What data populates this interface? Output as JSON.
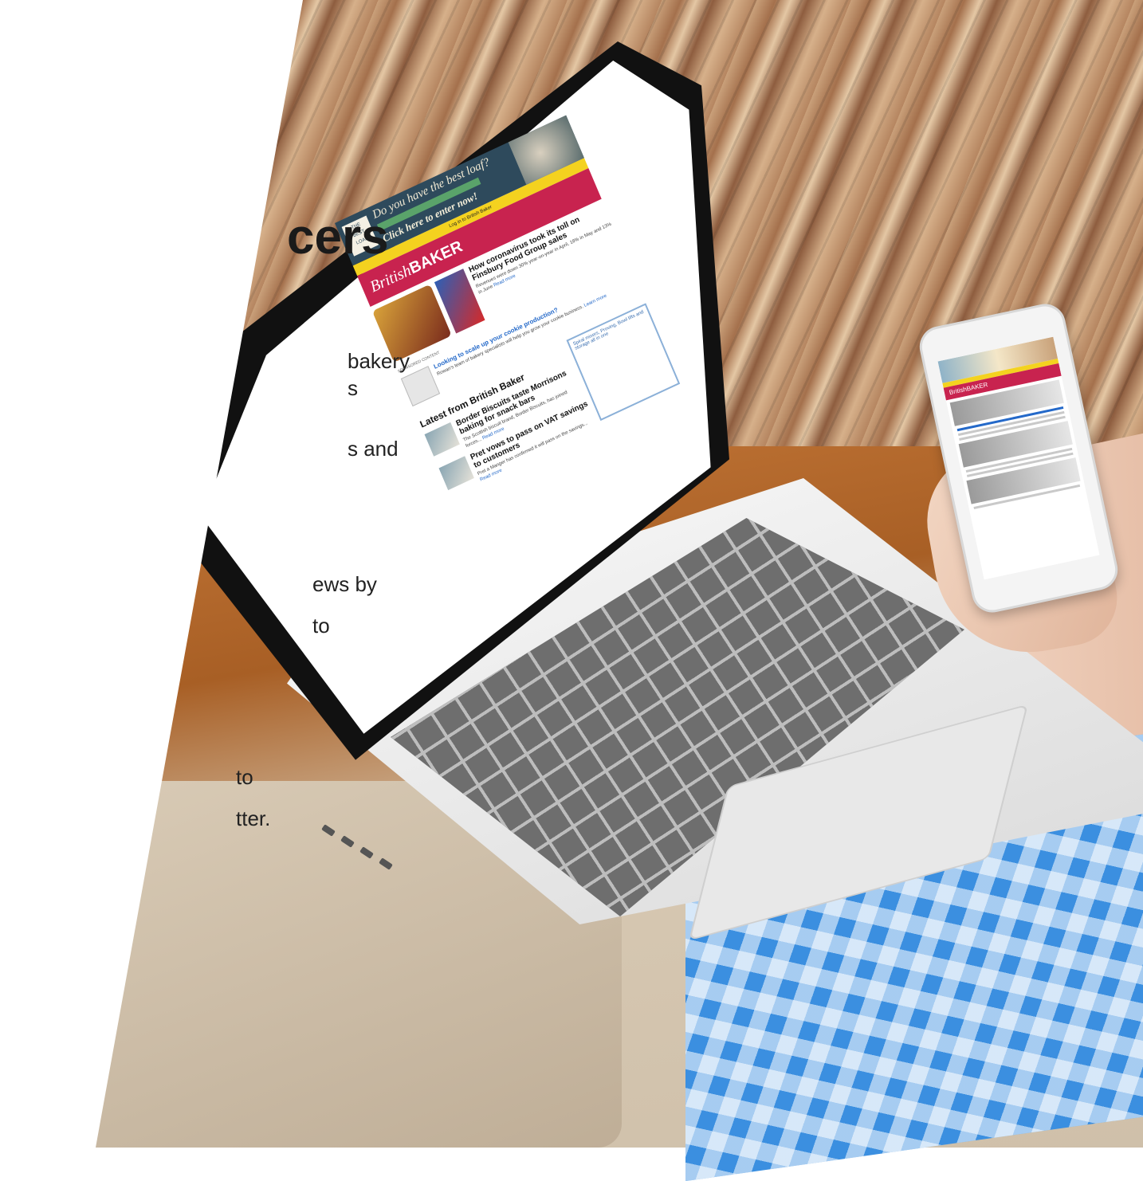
{
  "slide": {
    "heading": "cers",
    "body_lines": [
      "bakery",
      "s",
      "s and",
      "ews by",
      "to",
      "to",
      "tter."
    ]
  },
  "newsletter": {
    "banner_question": "Do you have the best loaf?",
    "banner_cta": "Click here to enter now!",
    "login_bar": "Log in to British Baker",
    "masthead_brit": "British",
    "masthead_baker": "BAKER",
    "lead_title": "How coronavirus took its toll on Finsbury Food Group sales",
    "lead_body": "Revenues were down 30% year-on-year in April, 18% in May and 13% in June",
    "lead_link": "Read more",
    "sponsored_label": "Sponsored content",
    "sponsored_title": "Looking to scale up your cookie production?",
    "sponsored_body": "Rowan's team of bakery specialists will help you grow your cookie business.",
    "sponsored_link": "Learn more",
    "latest_heading": "Latest from British Baker",
    "story1_title": "Border Biscuits taste Morrisons baking for snack bars",
    "story1_body": "The Scottish biscuit brand, Border Biscuits, has joined forces...",
    "story1_link": "Read more",
    "story2_title": "Pret vows to pass on VAT savings to customers",
    "story2_body": "Pret a Manger has confirmed it will pass on the savings...",
    "story2_link": "Read more",
    "ad_text": "Spiral mixers, Proving, Bowl lifts and storage all in one"
  },
  "phone": {
    "masthead": "BritishBAKER"
  }
}
